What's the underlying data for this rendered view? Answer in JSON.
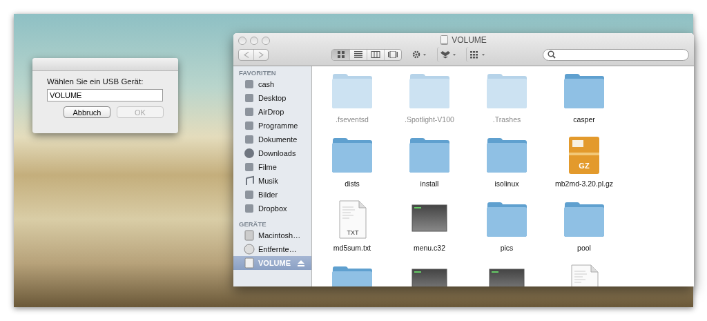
{
  "dialog": {
    "prompt": "Wählen Sie ein USB Gerät:",
    "value": "VOLUME",
    "buttons": [
      {
        "label": "Abbruch",
        "disabled": false
      },
      {
        "label": "OK",
        "disabled": true
      }
    ]
  },
  "finder": {
    "title": "VOLUME",
    "nav": [
      {
        "disabled": true
      },
      {
        "disabled": true
      }
    ],
    "views": [
      {
        "selected": true
      },
      {
        "selected": false
      },
      {
        "selected": false
      },
      {
        "selected": false
      }
    ],
    "sidebar": [
      {
        "heading": "FAVORITEN",
        "items": [
          {
            "label": "cash",
            "selected": false
          },
          {
            "label": "Desktop",
            "selected": false
          },
          {
            "label": "AirDrop",
            "selected": false
          },
          {
            "label": "Programme",
            "selected": false
          },
          {
            "label": "Dokumente",
            "selected": false
          },
          {
            "label": "Downloads",
            "selected": false
          },
          {
            "label": "Filme",
            "selected": false
          },
          {
            "label": "Musik",
            "selected": false
          },
          {
            "label": "Bilder",
            "selected": false
          },
          {
            "label": "Dropbox",
            "selected": false
          }
        ]
      },
      {
        "heading": "GERÄTE",
        "items": [
          {
            "label": "Macintosh…",
            "selected": false,
            "ejectable": false
          },
          {
            "label": "Entfernte…",
            "selected": false,
            "ejectable": false
          },
          {
            "label": "VOLUME",
            "selected": true,
            "ejectable": true
          }
        ]
      }
    ],
    "files": [
      {
        "name": ".fseventsd",
        "kind": "folder",
        "hidden": true
      },
      {
        "name": ".Spotlight-V100",
        "kind": "folder",
        "hidden": true
      },
      {
        "name": ".Trashes",
        "kind": "folder",
        "hidden": true
      },
      {
        "name": "casper",
        "kind": "folder",
        "hidden": false
      },
      {
        "name": "dists",
        "kind": "folder",
        "hidden": false
      },
      {
        "name": "install",
        "kind": "folder",
        "hidden": false
      },
      {
        "name": "isolinux",
        "kind": "folder",
        "hidden": false
      },
      {
        "name": "mb2md-3.20.pl.gz",
        "kind": "archive",
        "badge": "GZ",
        "hidden": false
      },
      {
        "name": "md5sum.txt",
        "kind": "text",
        "badge": "TXT",
        "hidden": false
      },
      {
        "name": "menu.c32",
        "kind": "exec",
        "hidden": false
      },
      {
        "name": "pics",
        "kind": "folder",
        "hidden": false
      },
      {
        "name": "pool",
        "kind": "folder",
        "hidden": false
      },
      {
        "kind": "folder",
        "hidden": false
      },
      {
        "kind": "exec",
        "hidden": false
      },
      {
        "kind": "exec",
        "hidden": false
      },
      {
        "kind": "text",
        "hidden": false
      }
    ]
  }
}
